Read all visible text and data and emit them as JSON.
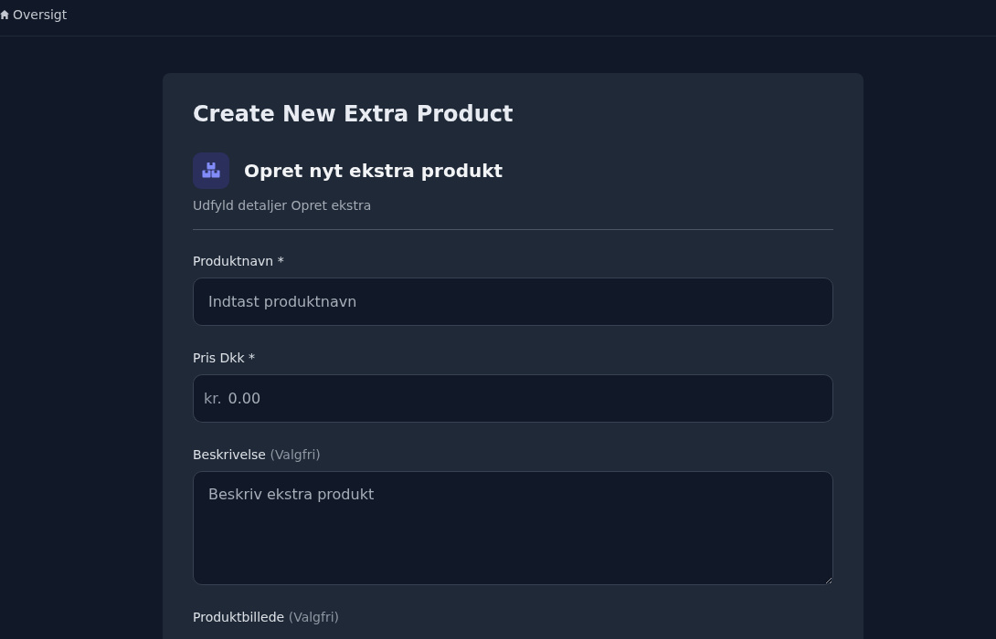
{
  "nav": {
    "link": "Oversigt"
  },
  "page_title": "Create New Extra Product",
  "form": {
    "heading": "Opret nyt ekstra produkt",
    "subtitle": "Udfyld detaljer Opret ekstra",
    "fields": [
      {
        "kind": "text",
        "label": "Produktnavn *",
        "placeholder": "Indtast produktnavn"
      },
      {
        "kind": "price",
        "label": "Pris Dkk *",
        "prefix": "kr.",
        "placeholder": "0.00"
      },
      {
        "kind": "textarea",
        "label": "Beskrivelse",
        "hint": "(Valgfri)",
        "placeholder": "Beskriv ekstra produkt"
      },
      {
        "kind": "file",
        "label": "Produktbillede",
        "hint": "(Valgfri)"
      }
    ]
  }
}
